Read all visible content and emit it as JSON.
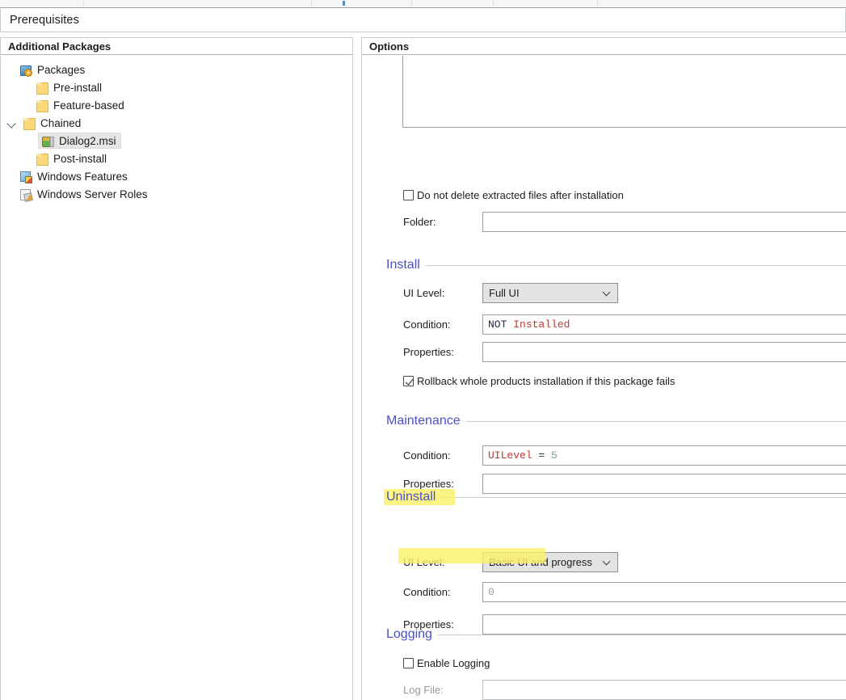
{
  "window": {
    "page_title": "Prerequisites"
  },
  "left_panel": {
    "header": "Additional Packages",
    "tree": [
      {
        "label": "Packages",
        "icon": "packages-icon",
        "depth": 0,
        "expanded": true,
        "selected": false
      },
      {
        "label": "Pre-install",
        "icon": "folder-icon",
        "depth": 1,
        "expanded": false,
        "selected": false
      },
      {
        "label": "Feature-based",
        "icon": "folder-icon",
        "depth": 1,
        "expanded": false,
        "selected": false
      },
      {
        "label": "Chained",
        "icon": "folder-icon",
        "depth": 1,
        "expanded": true,
        "selected": false
      },
      {
        "label": "Dialog2.msi",
        "icon": "msi-package-icon",
        "depth": 2,
        "expanded": false,
        "selected": true
      },
      {
        "label": "Post-install",
        "icon": "folder-icon",
        "depth": 1,
        "expanded": false,
        "selected": false
      },
      {
        "label": "Windows Features",
        "icon": "windows-features-icon",
        "depth": 0,
        "expanded": false,
        "selected": false
      },
      {
        "label": "Windows Server Roles",
        "icon": "windows-server-roles-icon",
        "depth": 0,
        "expanded": false,
        "selected": false
      }
    ]
  },
  "right_panel": {
    "header": "Options",
    "extract": {
      "command_line_value": "",
      "do_not_delete_label": "Do not delete extracted files after installation",
      "do_not_delete_checked": false,
      "folder_label": "Folder:",
      "folder_value": ""
    },
    "install": {
      "group_title": "Install",
      "ui_level_label": "UI Level:",
      "ui_level_value": "Full UI",
      "condition_label": "Condition:",
      "condition_tokens": [
        {
          "text": "NOT",
          "kind": "keyword"
        },
        {
          "text": " ",
          "kind": "plain"
        },
        {
          "text": "Installed",
          "kind": "identifier"
        }
      ],
      "properties_label": "Properties:",
      "properties_value": "",
      "rollback_label": "Rollback whole products installation if this package fails",
      "rollback_checked": true
    },
    "maintenance": {
      "group_title": "Maintenance",
      "condition_label": "Condition:",
      "condition_tokens": [
        {
          "text": "UILevel",
          "kind": "identifier"
        },
        {
          "text": " = ",
          "kind": "operator"
        },
        {
          "text": "5",
          "kind": "number"
        }
      ],
      "properties_label": "Properties:",
      "properties_value": ""
    },
    "uninstall": {
      "group_title": "Uninstall",
      "ui_level_label": "UI Level:",
      "ui_level_value": "Basic UI and progress",
      "condition_label": "Condition:",
      "condition_value": "0",
      "properties_label": "Properties:",
      "properties_value": "",
      "highlighted": true
    },
    "logging": {
      "group_title": "Logging",
      "enable_label": "Enable Logging",
      "enable_checked": false,
      "log_file_label": "Log File:",
      "log_file_value": "",
      "log_file_disabled": true
    }
  },
  "annotations": {
    "highlight_color": "#fbf06a",
    "marks": [
      {
        "target": "uninstall-group-title"
      },
      {
        "target": "uninstall-condition-row"
      }
    ]
  }
}
